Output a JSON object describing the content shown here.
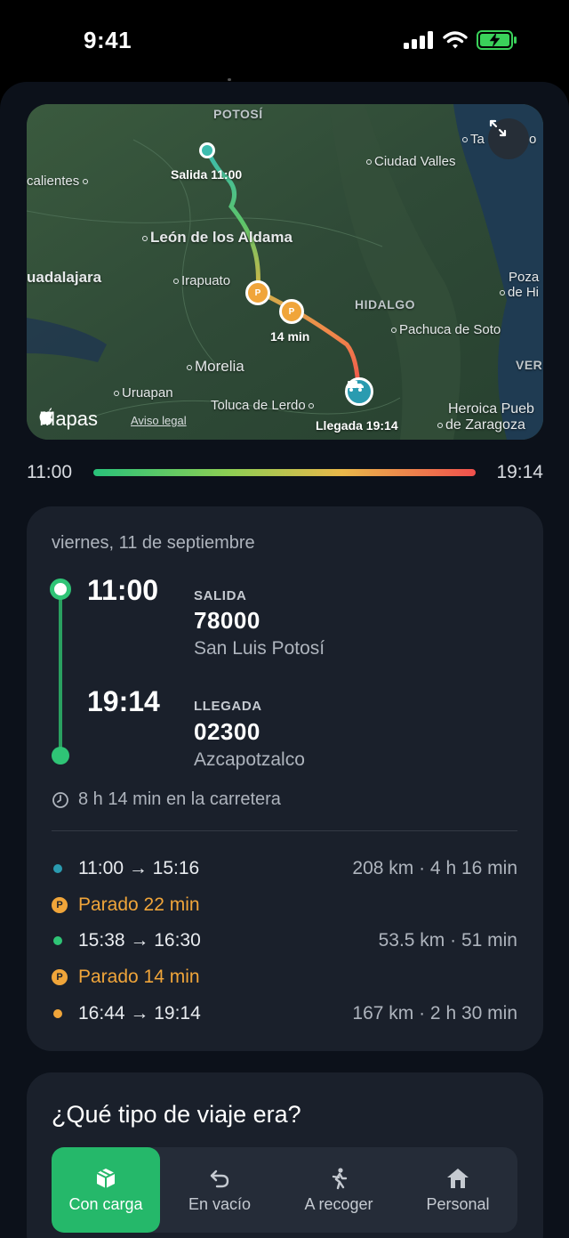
{
  "status": {
    "time": "9:41"
  },
  "map": {
    "labels": {
      "potosi": "POTOSÍ",
      "aguascalientes": "calientes",
      "ciudad_valles": "Ciudad Valles",
      "tampico": "Ta",
      "tampico_tail": "o",
      "leon": "León de los Aldama",
      "guadalajara": "uadalajara",
      "irapuato": "Irapuato",
      "hidalgo": "HIDALGO",
      "poza_rica": "Poza",
      "poza_rica2": "de Hi",
      "pachuca": "Pachuca de Soto",
      "morelia": "Morelia",
      "veracruz": "VER",
      "uruapan": "Uruapan",
      "toluca": "Toluca de Lerdo",
      "puebla": "Heroica Pueb",
      "puebla2": "de Zaragoza"
    },
    "salida_label": "Salida 11:00",
    "llegada_label": "Llegada 19:14",
    "stop_label": "14 min",
    "stop_marker": "P",
    "brand": "Mapas",
    "legal": "Aviso legal"
  },
  "timeline": {
    "start": "11:00",
    "end": "19:14"
  },
  "trip": {
    "date": "viernes, 11 de septiembre",
    "departure": {
      "time": "11:00",
      "label": "SALIDA",
      "postal": "78000",
      "place": "San Luis Potosí"
    },
    "arrival": {
      "time": "19:14",
      "label": "LLEGADA",
      "postal": "02300",
      "place": "Azcapotzalco"
    },
    "duration": "8 h 14 min en la carretera",
    "legs": [
      {
        "type": "leg",
        "time": "11:00 → 15:16",
        "meta": "208 km · 4 h 16 min",
        "color": "#2a9bb0"
      },
      {
        "type": "stop",
        "badge": "P",
        "text": "Parado 22 min"
      },
      {
        "type": "leg",
        "time": "15:38 → 16:30",
        "meta": "53.5 km · 51 min",
        "color": "#2fc476"
      },
      {
        "type": "stop",
        "badge": "P",
        "text": "Parado 14 min"
      },
      {
        "type": "leg",
        "time": "16:44 → 19:14",
        "meta": "167 km · 2 h 30 min",
        "color": "#f0a53a"
      }
    ]
  },
  "trip_type": {
    "question": "¿Qué tipo de viaje era?",
    "options": [
      {
        "label": "Con carga",
        "icon": "box-icon",
        "active": true
      },
      {
        "label": "En vacío",
        "icon": "return-arrow-icon",
        "active": false
      },
      {
        "label": "A recoger",
        "icon": "walking-person-icon",
        "active": false
      },
      {
        "label": "Personal",
        "icon": "home-icon",
        "active": false
      }
    ]
  },
  "colors": {
    "accent": "#25b86a",
    "stop": "#f0a53a",
    "card": "#1a202b"
  }
}
